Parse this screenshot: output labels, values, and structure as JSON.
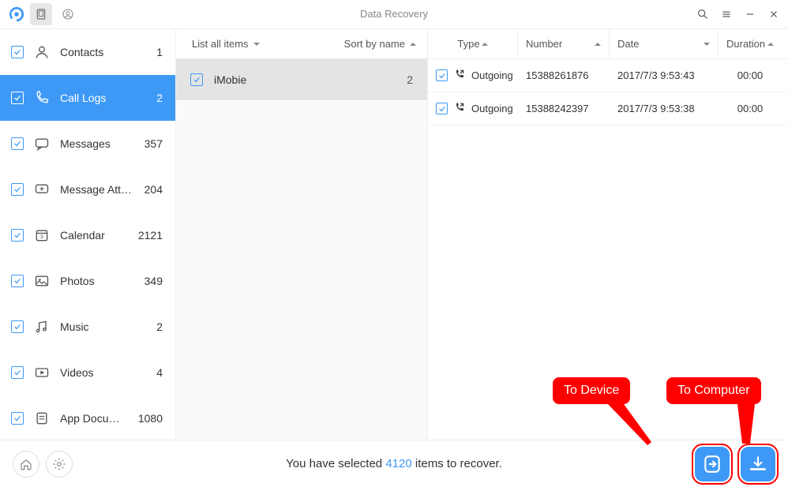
{
  "app": {
    "title": "Data Recovery"
  },
  "sidebar": {
    "items": [
      {
        "label": "Contacts",
        "count": "1"
      },
      {
        "label": "Call Logs",
        "count": "2"
      },
      {
        "label": "Messages",
        "count": "357"
      },
      {
        "label": "Message Attach...",
        "count": "204"
      },
      {
        "label": "Calendar",
        "count": "2121"
      },
      {
        "label": "Photos",
        "count": "349"
      },
      {
        "label": "Music",
        "count": "2"
      },
      {
        "label": "Videos",
        "count": "4"
      },
      {
        "label": "App Documents",
        "count": "1080"
      }
    ]
  },
  "mid": {
    "list_label": "List all items",
    "sort_label": "Sort by name",
    "rows": [
      {
        "label": "iMobie",
        "count": "2"
      }
    ]
  },
  "detail": {
    "headers": {
      "type": "Type",
      "number": "Number",
      "date": "Date",
      "duration": "Duration"
    },
    "rows": [
      {
        "type": "Outgoing",
        "number": "15388261876",
        "date": "2017/7/3 9:53:43",
        "duration": "00:00"
      },
      {
        "type": "Outgoing",
        "number": "15388242397",
        "date": "2017/7/3 9:53:38",
        "duration": "00:00"
      }
    ]
  },
  "footer": {
    "status_prefix": "You have selected ",
    "status_count": "4120",
    "status_suffix": " items to recover."
  },
  "callouts": {
    "to_device": "To Device",
    "to_computer": "To Computer"
  }
}
